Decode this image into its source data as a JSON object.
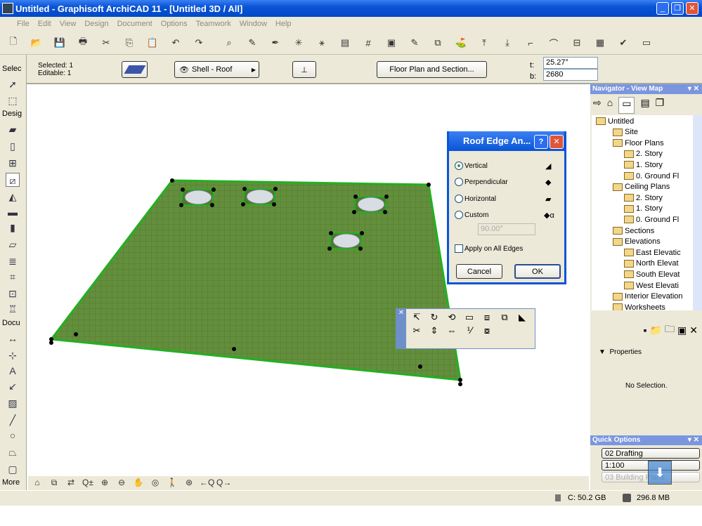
{
  "window": {
    "title": "Untitled - Graphisoft ArchiCAD 11 - [Untitled 3D / All]"
  },
  "menu": [
    "File",
    "Edit",
    "View",
    "Design",
    "Document",
    "Options",
    "Teamwork",
    "Window",
    "Help"
  ],
  "toolbar_icons": [
    "new-icon",
    "open-icon",
    "save-icon",
    "print-icon",
    "cut-icon",
    "copy-icon",
    "paste-icon",
    "undo-icon",
    "redo-icon",
    "find-select-icon",
    "eyedropper-icon",
    "syringe-icon",
    "magic-wand-icon",
    "suspend-groups-icon",
    "layer-icon",
    "grid-snap-icon",
    "layer-combo-icon",
    "pen-icon",
    "trace-icon",
    "story-icon",
    "elevation-icon",
    "section-icon",
    "detail-icon",
    "worksheet-icon",
    "interior-elevation-icon",
    "window-icon",
    "marker-icon",
    "zoom-window-icon"
  ],
  "infobox": {
    "selected": "Selected: 1",
    "editable": "Editable: 1",
    "layer": "Shell - Roof",
    "settings_button": "Floor Plan and Section...",
    "angle_label": "t:",
    "angle_value": "25.27°",
    "thickness_label": "b:",
    "thickness_value": "2680"
  },
  "toolbox": {
    "select_header": "Selec",
    "design_header": "Desig",
    "document_header": "Docu",
    "more": "More"
  },
  "navigator": {
    "title": "Navigator - View Map",
    "tree": [
      {
        "label": "Untitled",
        "level": 0
      },
      {
        "label": "Site",
        "level": 1
      },
      {
        "label": "Floor Plans",
        "level": 1
      },
      {
        "label": "2. Story",
        "level": 2
      },
      {
        "label": "1. Story",
        "level": 2
      },
      {
        "label": "0. Ground Fl",
        "level": 2
      },
      {
        "label": "Ceiling Plans",
        "level": 1
      },
      {
        "label": "2. Story",
        "level": 2
      },
      {
        "label": "1. Story",
        "level": 2
      },
      {
        "label": "0. Ground Fl",
        "level": 2
      },
      {
        "label": "Sections",
        "level": 1
      },
      {
        "label": "Elevations",
        "level": 1
      },
      {
        "label": "East Elevatic",
        "level": 2
      },
      {
        "label": "North Elevat",
        "level": 2
      },
      {
        "label": "South Elevat",
        "level": 2
      },
      {
        "label": "West Elevati",
        "level": 2
      },
      {
        "label": "Interior Elevation",
        "level": 1
      },
      {
        "label": "Worksheets",
        "level": 1
      }
    ],
    "properties_label": "Properties",
    "no_selection": "No Selection."
  },
  "quick_options": {
    "title": "Quick Options",
    "layer_combo": "02 Drafting",
    "scale": "1:100",
    "view": "03 Building Plans"
  },
  "dialog": {
    "title": "Roof Edge An...",
    "options": [
      "Vertical",
      "Perpendicular",
      "Horizontal",
      "Custom"
    ],
    "selected": "Vertical",
    "custom_value": "90.00°",
    "apply_all": "Apply on All Edges",
    "apply_all_checked": false,
    "cancel": "Cancel",
    "ok": "OK"
  },
  "status": {
    "disk": "C: 50.2 GB",
    "memory": "296.8 MB"
  },
  "colors": {
    "roof": "#5f8a3a",
    "roof_edge": "#22b022",
    "titlebar": "#0a54d6"
  }
}
